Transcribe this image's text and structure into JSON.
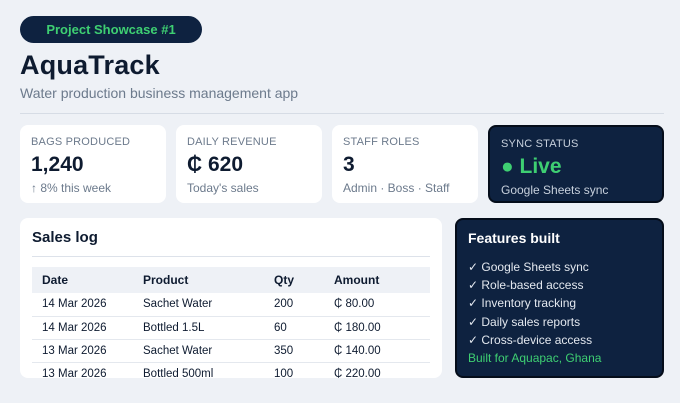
{
  "badge": "Project Showcase #1",
  "app": {
    "title": "AquaTrack",
    "subtitle": "Water production business management app"
  },
  "stats": [
    {
      "label": "BAGS PRODUCED",
      "value": "1,240",
      "sub": "↑ 8% this week"
    },
    {
      "label": "DAILY REVENUE",
      "value": "₵ 620",
      "sub": "Today's sales"
    },
    {
      "label": "STAFF ROLES",
      "value": "3",
      "sub": "Admin · Boss · Staff"
    },
    {
      "label": "SYNC STATUS",
      "value": "● Live",
      "sub": "Google Sheets sync"
    }
  ],
  "sales_log": {
    "title": "Sales log",
    "columns": [
      "Date",
      "Product",
      "Qty",
      "Amount"
    ],
    "rows": [
      [
        "14 Mar 2026",
        "Sachet Water",
        "200",
        "₵ 80.00"
      ],
      [
        "14 Mar 2026",
        "Bottled 1.5L",
        "60",
        "₵ 180.00"
      ],
      [
        "13 Mar 2026",
        "Sachet Water",
        "350",
        "₵ 140.00"
      ],
      [
        "13 Mar 2026",
        "Bottled 500ml",
        "100",
        "₵ 220.00"
      ]
    ]
  },
  "features": {
    "title": "Features built",
    "items": [
      "✓ Google Sheets sync",
      "✓ Role-based access",
      "✓ Inventory tracking",
      "✓ Daily sales reports",
      "✓ Cross-device access"
    ],
    "note": "Built for Aquapac, Ghana"
  },
  "colors": {
    "accent_green": "#3ecf72",
    "navy": "#0e2240",
    "background": "#eef1f6"
  }
}
